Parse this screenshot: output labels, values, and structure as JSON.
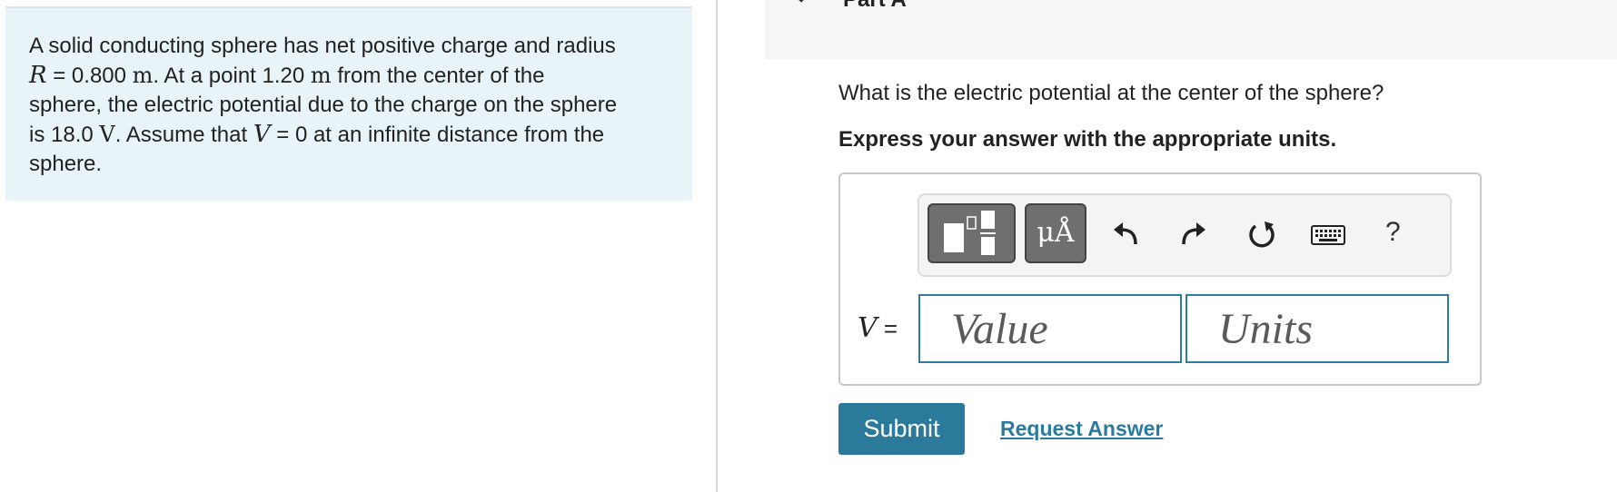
{
  "problem": {
    "line1": "A solid conducting sphere has net positive charge and radius",
    "r_var": "R",
    "r_eq": " = 0.800 ",
    "r_unit": "m",
    "line2b": ". At a point 1.20 ",
    "d_unit": "m",
    "line2c": " from the center of the",
    "line3": "sphere, the electric potential due to the charge on the sphere",
    "line4a": "is 18.0 ",
    "v_unit": "V",
    "line4b": ". Assume that ",
    "v_var": "V",
    "line4c": " = 0 at an infinite distance from the",
    "line5": "sphere."
  },
  "part": {
    "label": "Part A"
  },
  "question": {
    "text": "What is the electric potential at the center of the sphere?",
    "instruction": "Express your answer with the appropriate units."
  },
  "toolbar": {
    "units_label": "μÅ",
    "help_label": "?",
    "icons": [
      "templates-icon",
      "units-icon",
      "undo-icon",
      "redo-icon",
      "reset-icon",
      "keyboard-icon",
      "help-icon"
    ]
  },
  "answer": {
    "variable": "V",
    "equals": " =",
    "value_placeholder": "Value",
    "value": "",
    "units_placeholder": "Units",
    "units": ""
  },
  "actions": {
    "submit_label": "Submit",
    "request_label": "Request Answer"
  },
  "colors": {
    "accent": "#2b7a9b",
    "problem_bg": "#e8f4f7",
    "input_border": "#2f7d9e"
  }
}
